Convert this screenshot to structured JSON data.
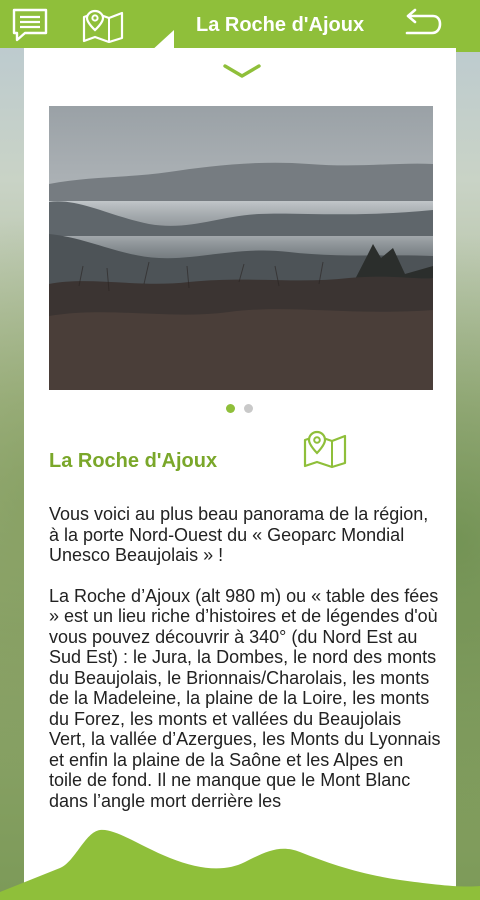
{
  "header": {
    "title": "La Roche d'Ajoux",
    "icons": [
      "chat-list-icon",
      "map-icon",
      "back-arrow-icon"
    ]
  },
  "colors": {
    "accent": "#8fbf3a",
    "title_green": "#7aa72a"
  },
  "carousel": {
    "total": 2,
    "active_index": 0
  },
  "content": {
    "title": "La Roche d'Ajoux",
    "paragraph1": "Vous voici au plus beau panorama de la région, à la porte Nord-Ouest du « Geoparc Mondial Unesco Beaujolais » !",
    "paragraph2": "La Roche d’Ajoux (alt 980 m) ou « table des fées » est un lieu riche d’histoires et de légendes d'où vous pouvez découvrir à 340° (du Nord Est au Sud Est) : le Jura, la Dombes, le nord des monts du Beaujolais, le Brionnais/Charolais, les monts de la Madeleine, la plaine de la Loire, les monts du Forez, les monts et vallées du Beaujolais Vert, la vallée d’Azergues, les Monts du Lyonnais et enfin la plaine de la Saône et les Alpes en toile de fond. Il ne manque que le Mont Blanc dans l’angle mort derrière les"
  }
}
